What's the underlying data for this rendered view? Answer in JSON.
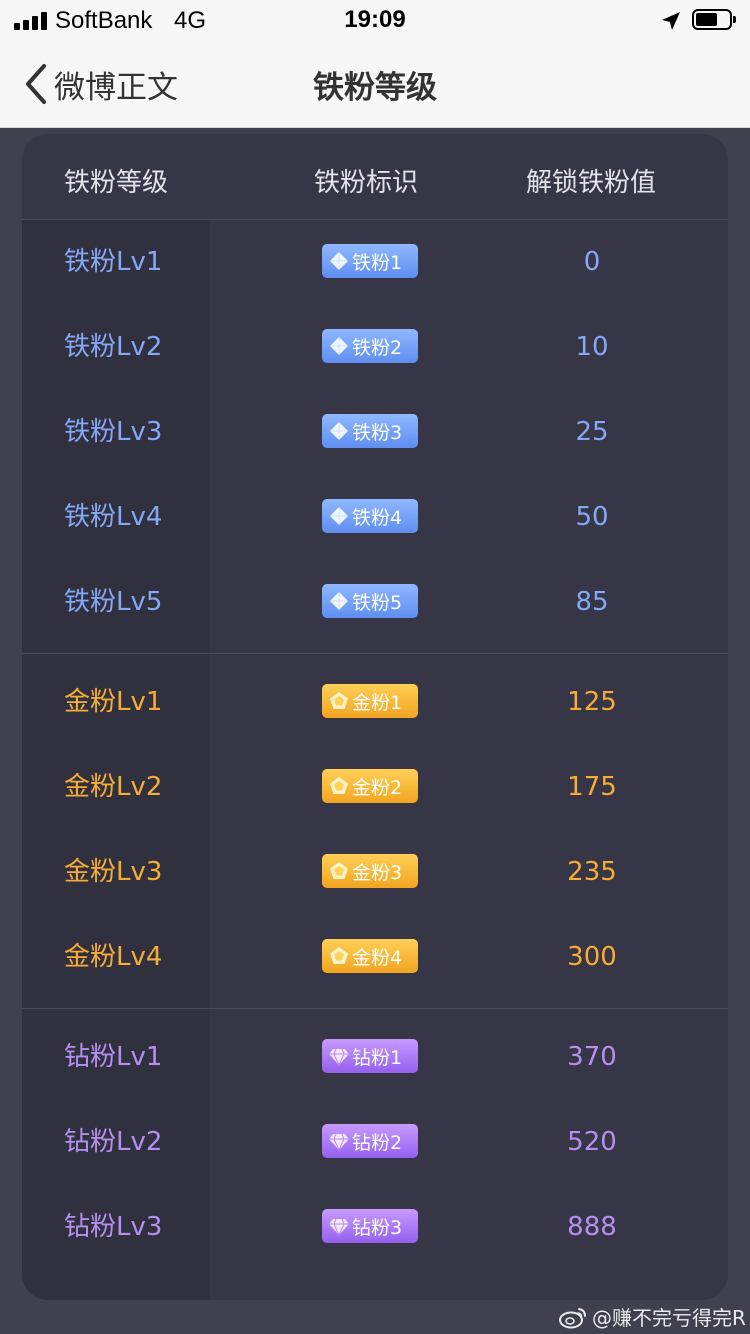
{
  "status_bar": {
    "carrier": "SoftBank",
    "network": "4G",
    "time": "19:09",
    "battery_level": 0.65
  },
  "nav": {
    "back_label": "微博正文",
    "title": "铁粉等级"
  },
  "table": {
    "headers": {
      "level": "铁粉等级",
      "badge": "铁粉标识",
      "value": "解锁铁粉值"
    },
    "groups": [
      {
        "color": "#84a8f5",
        "icon": "diamond-icon",
        "rows": [
          {
            "level": "铁粉Lv1",
            "badge": "铁粉1",
            "value": "0"
          },
          {
            "level": "铁粉Lv2",
            "badge": "铁粉2",
            "value": "10"
          },
          {
            "level": "铁粉Lv3",
            "badge": "铁粉3",
            "value": "25"
          },
          {
            "level": "铁粉Lv4",
            "badge": "铁粉4",
            "value": "50"
          },
          {
            "level": "铁粉Lv5",
            "badge": "铁粉5",
            "value": "85"
          }
        ]
      },
      {
        "color": "#f6ad35",
        "icon": "pentagon-gem-icon",
        "rows": [
          {
            "level": "金粉Lv1",
            "badge": "金粉1",
            "value": "125"
          },
          {
            "level": "金粉Lv2",
            "badge": "金粉2",
            "value": "175"
          },
          {
            "level": "金粉Lv3",
            "badge": "金粉3",
            "value": "235"
          },
          {
            "level": "金粉Lv4",
            "badge": "金粉4",
            "value": "300"
          }
        ]
      },
      {
        "color": "#b58ff0",
        "icon": "gem-icon",
        "rows": [
          {
            "level": "钻粉Lv1",
            "badge": "钻粉1",
            "value": "370"
          },
          {
            "level": "钻粉Lv2",
            "badge": "钻粉2",
            "value": "520"
          },
          {
            "level": "钻粉Lv3",
            "badge": "钻粉3",
            "value": "888"
          }
        ]
      }
    ]
  },
  "watermark": {
    "icon": "weibo-logo-icon",
    "text": "@赚不完亏得完R"
  }
}
